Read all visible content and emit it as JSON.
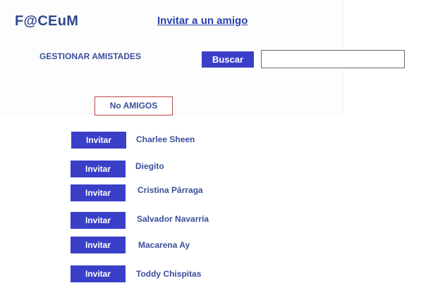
{
  "header": {
    "logo": "F@CEuM",
    "invite_link": "Invitar a un amigo"
  },
  "manage": {
    "title": "GESTIONAR AMISTADES",
    "search_button": "Buscar",
    "search_value": ""
  },
  "filter": {
    "label": "No AMIGOS"
  },
  "people": [
    {
      "name": "Charlee Sheen",
      "button": "Invitar"
    },
    {
      "name": "Diegito",
      "button": "Invitar"
    },
    {
      "name": "Cristina Párraga",
      "button": "Invitar"
    },
    {
      "name": "Salvador Navarría",
      "button": "Invitar"
    },
    {
      "name": "Macarena Ay",
      "button": "Invitar"
    },
    {
      "name": "Toddy Chispitas",
      "button": "Invitar"
    }
  ],
  "colors": {
    "button_bg": "#3a3fc8",
    "text_blue": "#3a4f9a",
    "link_blue": "#2a3fb0",
    "filter_border": "#b84a4a"
  }
}
